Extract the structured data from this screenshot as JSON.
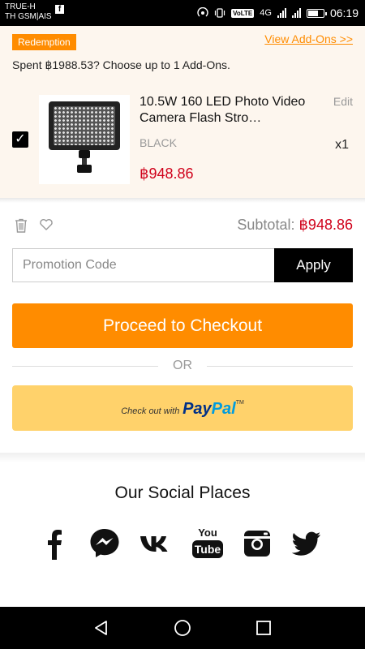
{
  "status_bar": {
    "carrier_line1": "TRUE-H",
    "carrier_line2": "TH GSM|AIS",
    "fb_badge": "f",
    "network": "4G",
    "volte": "VoLTE",
    "time": "06:19"
  },
  "redemption": {
    "badge": "Redemption",
    "view_addons": "View Add-Ons >>",
    "spent_text": "Spent ฿1988.53? Choose up to 1 Add-Ons."
  },
  "cart_item": {
    "checked": true,
    "checkmark": "✓",
    "title": "10.5W 160 LED Photo Video Camera Flash Stro…",
    "edit": "Edit",
    "variant": "BLACK",
    "quantity": "x1",
    "price": "฿948.86"
  },
  "summary": {
    "subtotal_label": "Subtotal:",
    "subtotal_amount": "฿948.86"
  },
  "promo": {
    "placeholder": "Promotion Code",
    "apply_label": "Apply"
  },
  "checkout": {
    "proceed_label": "Proceed to Checkout",
    "or_label": "OR",
    "paypal_prefix": "Check out with",
    "paypal_pay": "Pay",
    "paypal_pal": "Pal",
    "paypal_tm": "TM"
  },
  "social": {
    "title": "Our Social Places",
    "icons": [
      "facebook-icon",
      "messenger-icon",
      "vk-icon",
      "youtube-icon",
      "instagram-icon",
      "twitter-icon"
    ],
    "youtube_text_top": "You",
    "youtube_text_bottom": "Tube"
  },
  "colors": {
    "accent": "#ff8c00",
    "price": "#d0021b",
    "paypal_bg": "#ffd26b",
    "redemption_bg": "#fdf6ee"
  }
}
